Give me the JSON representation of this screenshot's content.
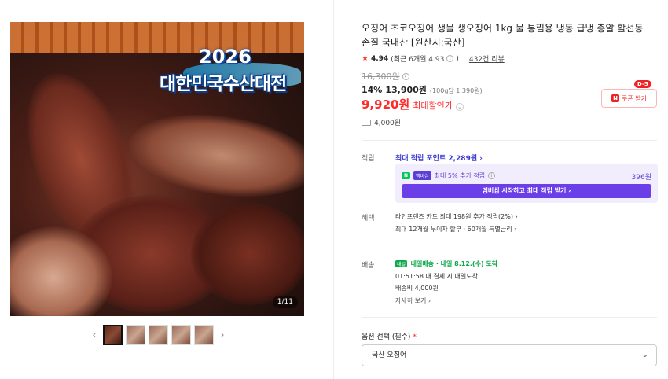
{
  "gallery": {
    "badge_year": "2026",
    "badge_title": "대한민국수산대전",
    "counter": "1/11",
    "prev_arrow": "‹",
    "next_arrow": "›"
  },
  "product": {
    "title": "오징어 초코오징어 생물 생오징어 1kg 물 통찜용 냉동 급냉 총알 활선동 손질 국내산 [원산지:국산]",
    "rating": "4.94",
    "rating_recent": "(최근 6개월 4.93",
    "reviews": "432건 리뷰",
    "original_price": "16,300원",
    "discount_pct": "14%",
    "sale_price": "13,900원",
    "unit_price": "(100g당 1,390원)",
    "best_price": "9,920원",
    "best_price_label": "최대할인가",
    "shipping_fee": "4,000원",
    "coupon_label": "쿠폰 받기",
    "coupon_dday": "D-5"
  },
  "points": {
    "label": "적립",
    "link_text": "최대 적립 포인트 2,289원",
    "member_text": "최대 5% 추가 적립",
    "member_amount": "396원",
    "member_button": "멤버십 시작하고 최대 적립 받기",
    "npay_badge": "N",
    "plus_badge": "멤버십"
  },
  "benefits": {
    "label": "혜택",
    "line1": "라인프렌즈 카드 최대 198원 추가 적립(2%)",
    "line2": "최대 12개월 무이자 할부 · 60개월 특별금리"
  },
  "delivery": {
    "label": "배송",
    "badge": "내일",
    "line1": "내일배송 · 내일 8.12.(수) 도착",
    "line2": "01:51:58  내 결제 시 내일도착",
    "line3": "배송비 4,000원",
    "detail_link": "자세히 보기"
  },
  "option": {
    "label": "옵션 선택 (필수)",
    "required_mark": "*",
    "selected": "국산 오징어"
  }
}
